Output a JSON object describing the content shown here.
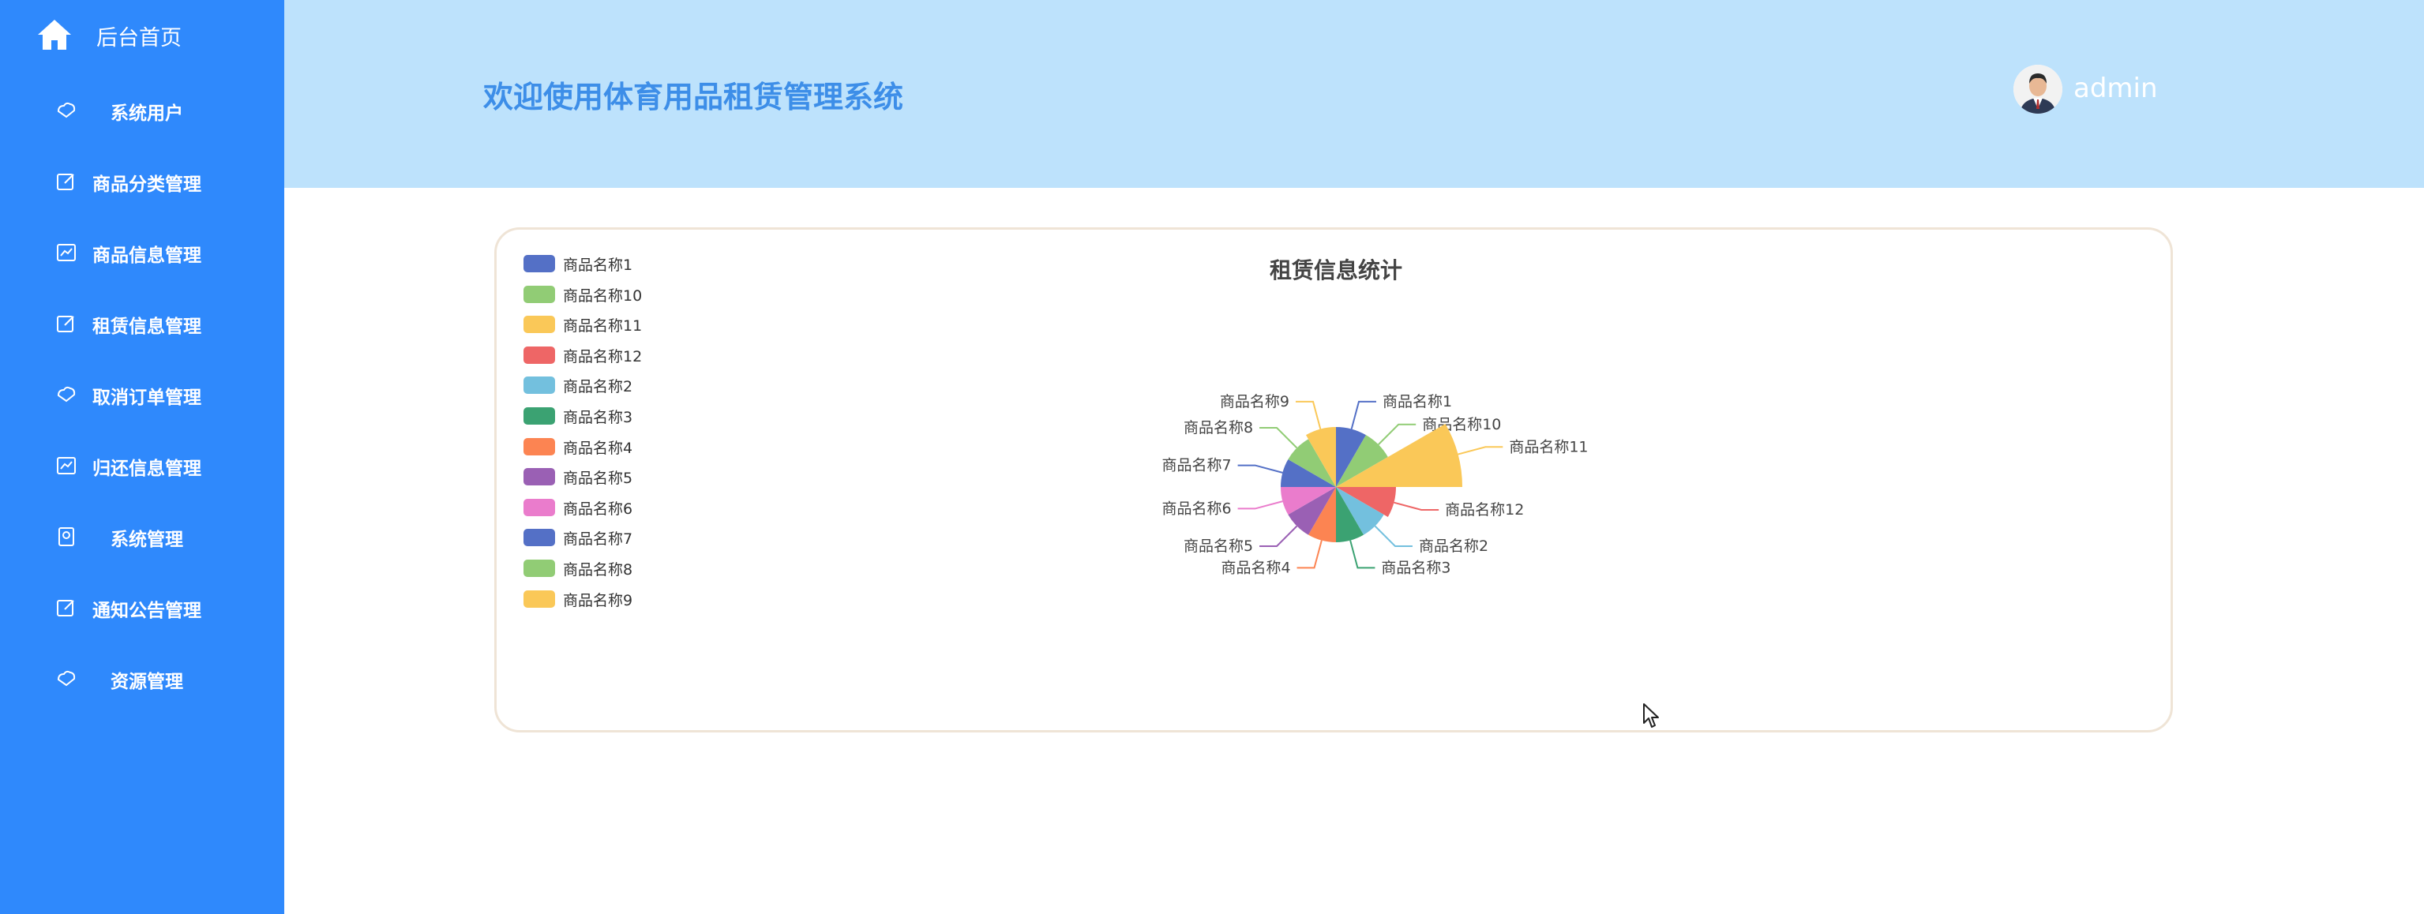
{
  "sidebar": {
    "home_label": "后台首页",
    "items": [
      {
        "label": "系统用户",
        "icon": "cloud-icon"
      },
      {
        "label": "商品分类管理",
        "icon": "edit-icon"
      },
      {
        "label": "商品信息管理",
        "icon": "chart-icon"
      },
      {
        "label": "租赁信息管理",
        "icon": "edit-icon"
      },
      {
        "label": "取消订单管理",
        "icon": "cloud-icon"
      },
      {
        "label": "归还信息管理",
        "icon": "chart-icon"
      },
      {
        "label": "系统管理",
        "icon": "badge-icon"
      },
      {
        "label": "通知公告管理",
        "icon": "edit-icon"
      },
      {
        "label": "资源管理",
        "icon": "cloud-icon"
      }
    ]
  },
  "header": {
    "title": "欢迎使用体育用品租赁管理系统",
    "username": "admin"
  },
  "colors": {
    "sidebar": "#2f89fc",
    "header": "#bde2fc",
    "title": "#3d8ee8"
  },
  "chart_data": {
    "type": "pie",
    "variant": "rose",
    "title": "租赁信息统计",
    "legend_position": "top-left",
    "categories": [
      "商品名称1",
      "商品名称10",
      "商品名称11",
      "商品名称12",
      "商品名称2",
      "商品名称3",
      "商品名称4",
      "商品名称5",
      "商品名称6",
      "商品名称7",
      "商品名称8",
      "商品名称9"
    ],
    "values": [
      2,
      2,
      9,
      2,
      1.5,
      1.5,
      1.5,
      1.5,
      1.5,
      1.5,
      1.5,
      2
    ],
    "colors": [
      "#5470c6",
      "#91cc75",
      "#fac858",
      "#ee6666",
      "#73c0de",
      "#3ba272",
      "#fc8452",
      "#9a60b4",
      "#ea7ccc",
      "#5470c6",
      "#91cc75",
      "#fac858"
    ]
  }
}
